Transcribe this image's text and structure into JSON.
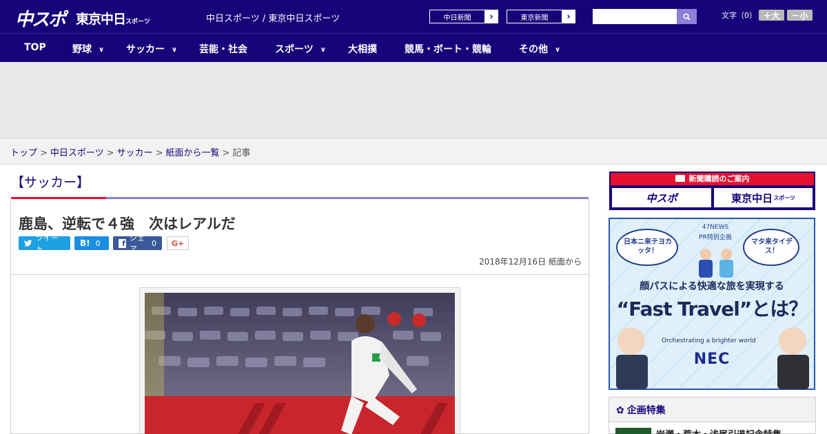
{
  "header": {
    "logo_main": "中スポ",
    "logo_tokyo": "東京中日",
    "logo_tokyo_suffix": "スポーツ",
    "site_subtitle": "中日スポーツ / 東京中日スポーツ",
    "newspaper_links": [
      "中日新聞",
      "東京新聞"
    ],
    "search": {
      "placeholder": ""
    },
    "font_size_label": "文字（0）",
    "font_bigger": "＋大",
    "font_smaller": "－小"
  },
  "nav": {
    "items": [
      {
        "label": "TOP",
        "has_submenu": false
      },
      {
        "label": "野球",
        "has_submenu": true
      },
      {
        "label": "サッカー",
        "has_submenu": true
      },
      {
        "label": "芸能・社会",
        "has_submenu": false
      },
      {
        "label": "スポーツ",
        "has_submenu": true
      },
      {
        "label": "大相撲",
        "has_submenu": false
      },
      {
        "label": "競馬・ボート・競輪",
        "has_submenu": false
      },
      {
        "label": "その他",
        "has_submenu": true
      }
    ]
  },
  "breadcrumb": {
    "items": [
      "トップ",
      "中日スポーツ",
      "サッカー",
      "紙面から一覧"
    ],
    "current": "記事",
    "separator": ">"
  },
  "article": {
    "category": "【サッカー】",
    "title": "鹿島、逆転で４強　次はレアルだ",
    "share": {
      "tweet": "ツイート",
      "hatena": "B!",
      "hatena_count": "0",
      "facebook": "シェア",
      "facebook_count": "0",
      "gplus": "G+"
    },
    "date": "2018年12月16日 紙面から"
  },
  "sidebar": {
    "subscription_header": "新聞購読のご案内",
    "subscription_buttons": [
      "中スポ",
      "東京中日"
    ],
    "subscription_suffix": "スポーツ",
    "pr": {
      "bubble_left": "日本ニ来テヨカッタ！",
      "bubble_right": "マタ来タイデス！",
      "tag_line1": "47NEWS",
      "tag_line2": "PR特別企画",
      "headline": "顔パスによる快適な旅を実現する",
      "big": "“Fast Travel”とは？",
      "tagline": "Orchestrating a brighter world",
      "brand": "NEC"
    },
    "feature_title": "企画特集",
    "feature_item": "岩瀬・荒木・浅尾引退記念特集"
  },
  "colors": {
    "brand_navy": "#16037a",
    "accent_red": "#e8102f"
  }
}
